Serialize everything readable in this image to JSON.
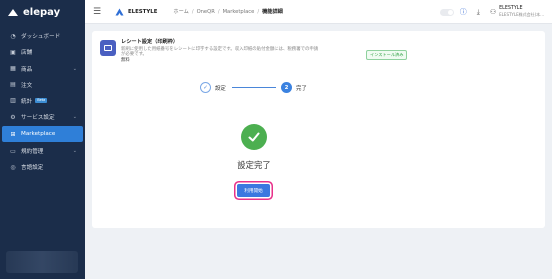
{
  "sidebar": {
    "logo": "elepay",
    "items": [
      {
        "label": "ダッシュボード",
        "icon": "clock-icon",
        "chevron": false
      },
      {
        "label": "店舗",
        "icon": "store-icon",
        "chevron": false
      },
      {
        "label": "商品",
        "icon": "box-icon",
        "chevron": true
      },
      {
        "label": "注文",
        "icon": "document-icon",
        "chevron": false
      },
      {
        "label": "統計",
        "icon": "chart-icon",
        "chevron": false,
        "tag": "Beta"
      },
      {
        "label": "サービス設定",
        "icon": "gear-icon",
        "chevron": true
      },
      {
        "label": "Marketplace",
        "icon": "grid-icon",
        "chevron": false,
        "active": true
      },
      {
        "label": "規約管理",
        "icon": "doc-icon",
        "chevron": true
      },
      {
        "label": "言語設定",
        "icon": "globe-icon",
        "chevron": false
      }
    ]
  },
  "header": {
    "brand": "ELESTYLE",
    "breadcrumb": [
      "ホーム",
      "OneQR",
      "Marketplace",
      "機能詳細"
    ],
    "user_name": "ELESTYLE",
    "user_sub": "ELESTYLE株式会社(本..."
  },
  "app": {
    "title": "レシート設定（印刷枠）",
    "description_line1": "新刷に使用した用紙番号をレシートに印字する設定です。収入印紙の貼付金額には、税務署での申請",
    "description_line2": "が必要です。",
    "price": "無料",
    "installed_label": "インストール済み"
  },
  "steps": [
    {
      "label": "設定",
      "marker": "✓"
    },
    {
      "label": "完了",
      "marker": "2"
    }
  ],
  "result": {
    "title": "設定完了",
    "button_label": "利用開始"
  },
  "colors": {
    "sidebar_bg": "#1b2d4a",
    "accent": "#3b78e0",
    "success": "#4caf50",
    "focus_ring": "#e8318a"
  }
}
